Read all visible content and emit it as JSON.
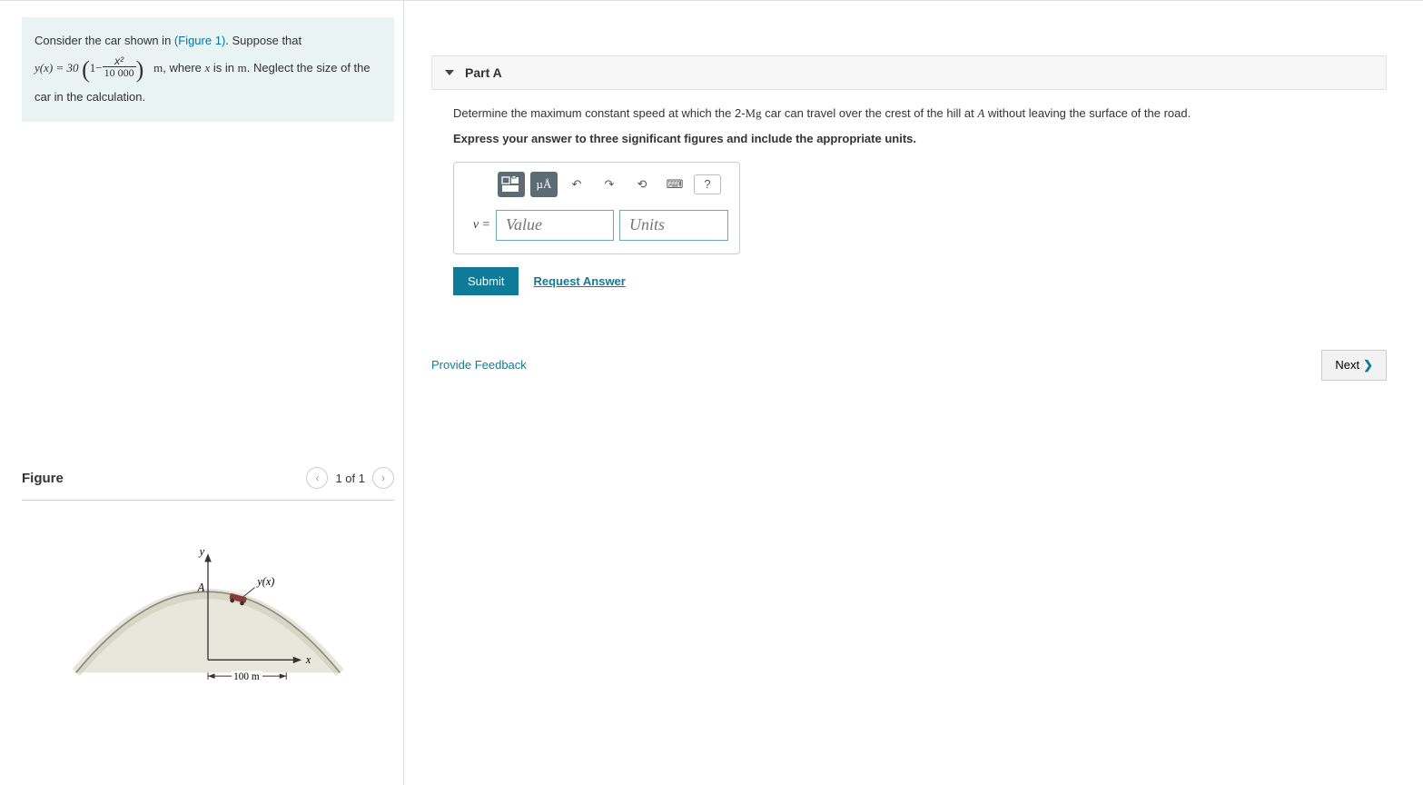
{
  "left": {
    "intro_pre": "Consider the car shown in ",
    "figure_link": "(Figure 1)",
    "intro_post": ". Suppose that",
    "eq_lhs": "y(x) = 30",
    "eq_num": "x²",
    "eq_den": "10 000",
    "eq_tail": "m, where x is in m. Neglect the size of the",
    "intro_line3": "car in the calculation."
  },
  "figure": {
    "title": "Figure",
    "pager": "1 of 1",
    "labels": {
      "y": "y",
      "A": "A",
      "curve": "y(x)",
      "x": "x",
      "dist": "100 m"
    }
  },
  "right": {
    "part_label": "Part A",
    "statement_pre": "Determine the maximum constant speed at which the 2-",
    "mg": "Mg",
    "statement_mid": " car can travel over the crest of the hill at ",
    "A": "A",
    "statement_post": " without leaving the surface of the road.",
    "instruction": "Express your answer to three significant figures and include the appropriate units.",
    "toolbar": {
      "units_tool": "µÅ",
      "help": "?"
    },
    "veq": "v =",
    "value_ph": "Value",
    "units_ph": "Units",
    "submit": "Submit",
    "request": "Request Answer",
    "feedback": "Provide Feedback",
    "next": "Next"
  }
}
